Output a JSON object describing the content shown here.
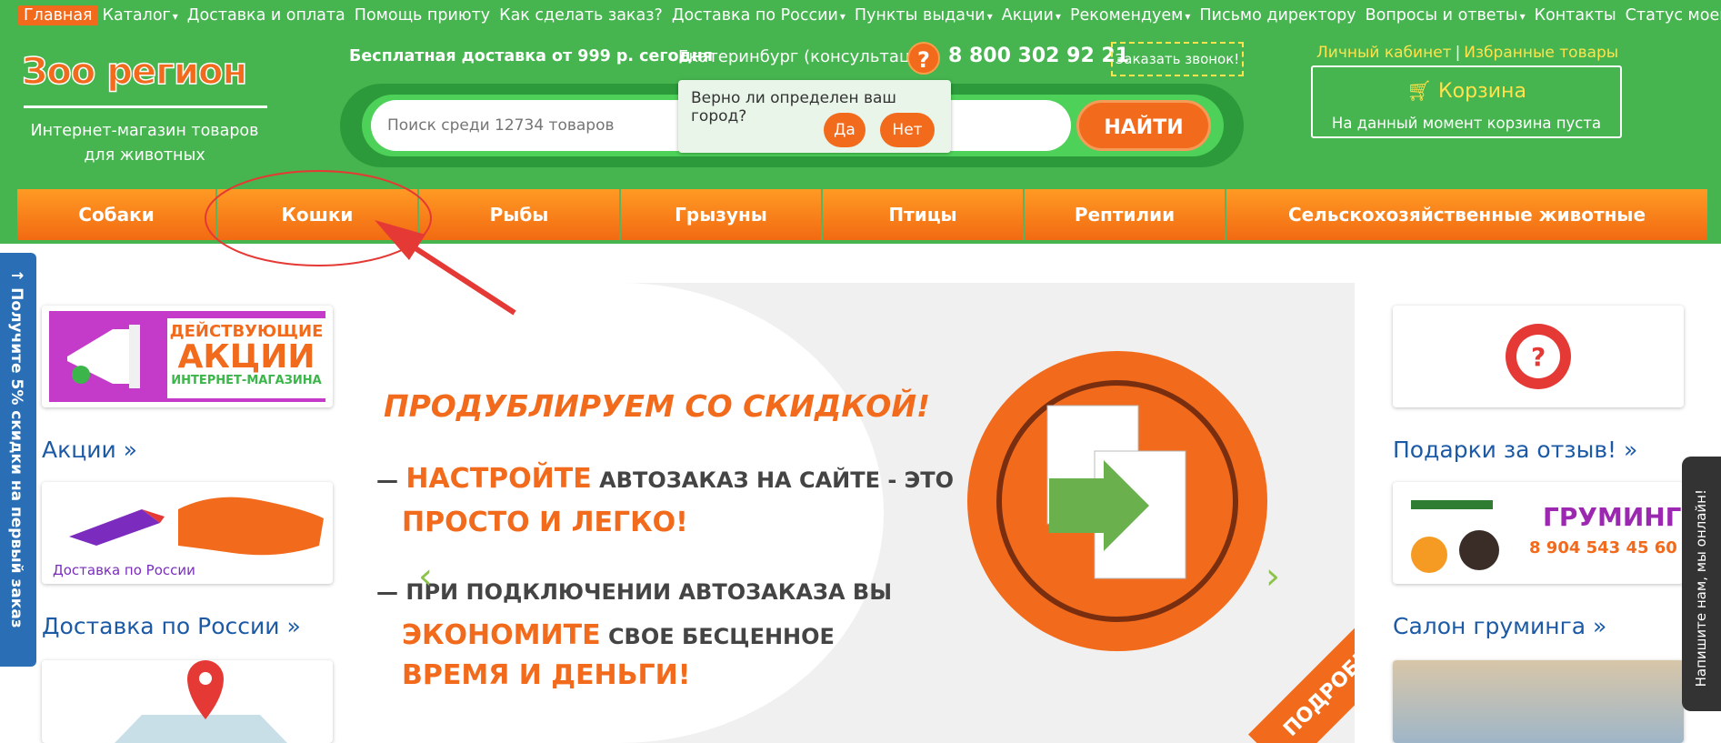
{
  "top_menu": [
    {
      "label": "Главная",
      "dropdown": false,
      "active": true
    },
    {
      "label": "Каталог",
      "dropdown": true
    },
    {
      "label": "Доставка и оплата",
      "dropdown": false
    },
    {
      "label": "Помощь приюту",
      "dropdown": false
    },
    {
      "label": "Как сделать заказ?",
      "dropdown": false
    },
    {
      "label": "Доставка по России",
      "dropdown": true
    },
    {
      "label": "Пункты выдачи",
      "dropdown": true
    },
    {
      "label": "Акции",
      "dropdown": true
    },
    {
      "label": "Рекомендуем",
      "dropdown": true
    },
    {
      "label": "Письмо директору",
      "dropdown": false
    },
    {
      "label": "Вопросы и ответы",
      "dropdown": true
    },
    {
      "label": "Контакты",
      "dropdown": false
    },
    {
      "label": "Статус моего заказа",
      "dropdown": false
    }
  ],
  "logo": {
    "text": "Зоо регион",
    "tagline": "Интернет-магазин товаров для животных"
  },
  "header": {
    "free_delivery": "Бесплатная доставка от 999 р. сегодня",
    "city": "Екатеринбург (консультация)",
    "help_glyph": "?",
    "phone": "8 800 302 92 21",
    "callback": "Заказать звонок!"
  },
  "search": {
    "placeholder": "Поиск среди 12734 товаров",
    "button": "НАЙТИ"
  },
  "city_popup": {
    "question": "Верно ли определен ваш город?",
    "yes": "Да",
    "no": "Нет"
  },
  "user_links": {
    "account": "Личный кабинет",
    "sep": "|",
    "favorites": "Избранные товары"
  },
  "cart": {
    "title": "Корзина",
    "status": "На данный момент корзина пуста"
  },
  "categories": [
    "Собаки",
    "Кошки",
    "Рыбы",
    "Грызуны",
    "Птицы",
    "Рептилии",
    "Сельскохозяйственные животные"
  ],
  "left_column": {
    "promo_banner": {
      "line1": "ДЕЙСТВУЮЩИЕ",
      "line2": "АКЦИИ",
      "line3": "ИНТЕРНЕТ-МАГАЗИНА"
    },
    "promo_link": "Акции »",
    "delivery_banner": "Доставка по России",
    "delivery_link": "Доставка по России »"
  },
  "slider": {
    "heading": "ПРОДУБЛИРУЕМ СО СКИДКОЙ!",
    "b1_dash": "—",
    "b1_a": "НАСТРОЙТЕ",
    "b1_b": "АВТОЗАКАЗ НА САЙТЕ - ЭТО",
    "b1_c": "ПРОСТО И ЛЕГКО!",
    "b2_dash": "—",
    "b2_a": "ПРИ ПОДКЛЮЧЕНИИ АВТОЗАКАЗА ВЫ",
    "b2_b": "ЭКОНОМИТЕ",
    "b2_c": "СВОЕ БЕСЦЕННОЕ",
    "b2_d": "ВРЕМЯ И ДЕНЬГИ!",
    "corner": "ПОДРОБНЕЕ"
  },
  "right_column": {
    "reviews_link": "Подарки за отзыв! »",
    "grooming_banner_title": "ГРУМИНГ",
    "grooming_banner_phone": "8 904 543 45 60",
    "grooming_link": "Салон груминга »"
  },
  "side_tab": "↑ Получите 5% скидки на первый заказ",
  "chat_tab": "Напишите нам, мы онлайн!"
}
